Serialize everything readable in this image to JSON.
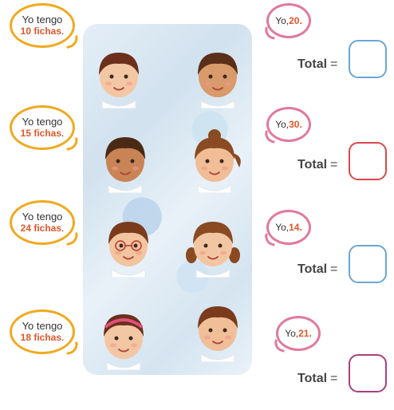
{
  "rows": [
    {
      "left_line1": "Yo tengo",
      "left_line2": "10 fichas",
      "right_prefix": "Yo, ",
      "right_value": "20",
      "total_label": "Total",
      "eq": "=",
      "box_color": "#6aa6d8"
    },
    {
      "left_line1": "Yo tengo",
      "left_line2": "15 fichas",
      "right_prefix": "Yo, ",
      "right_value": "30",
      "total_label": "Total",
      "eq": "=",
      "box_color": "#d64a4a"
    },
    {
      "left_line1": "Yo tengo",
      "left_line2": "24 fichas",
      "right_prefix": "Yo, ",
      "right_value": "14",
      "total_label": "Total",
      "eq": "=",
      "box_color": "#6aa6d8"
    },
    {
      "left_line1": "Yo tengo",
      "left_line2": "18 fichas",
      "right_prefix": "Yo, ",
      "right_value": "21",
      "total_label": "Total",
      "eq": "=",
      "box_color": "#a8407e"
    }
  ],
  "faces": [
    {
      "name": "girl-short-hair",
      "hair": "#6b2f1c",
      "skin": "#f4c7a4"
    },
    {
      "name": "boy-dark-hair",
      "hair": "#5a2f18",
      "skin": "#d99a6c"
    },
    {
      "name": "boy-spiky-hair",
      "hair": "#4a2a14",
      "skin": "#c98456"
    },
    {
      "name": "girl-bun-hair",
      "hair": "#8a4a22",
      "skin": "#f1bd97"
    },
    {
      "name": "boy-glasses",
      "hair": "#7a3a1c",
      "skin": "#f2c4a0"
    },
    {
      "name": "girl-pigtails",
      "hair": "#8a4a22",
      "skin": "#f3c6a2"
    },
    {
      "name": "girl-headband",
      "hair": "#6b2f1c",
      "skin": "#f4c7a4"
    },
    {
      "name": "boy-side-hair",
      "hair": "#7a3a1c",
      "skin": "#f0bf98"
    }
  ]
}
